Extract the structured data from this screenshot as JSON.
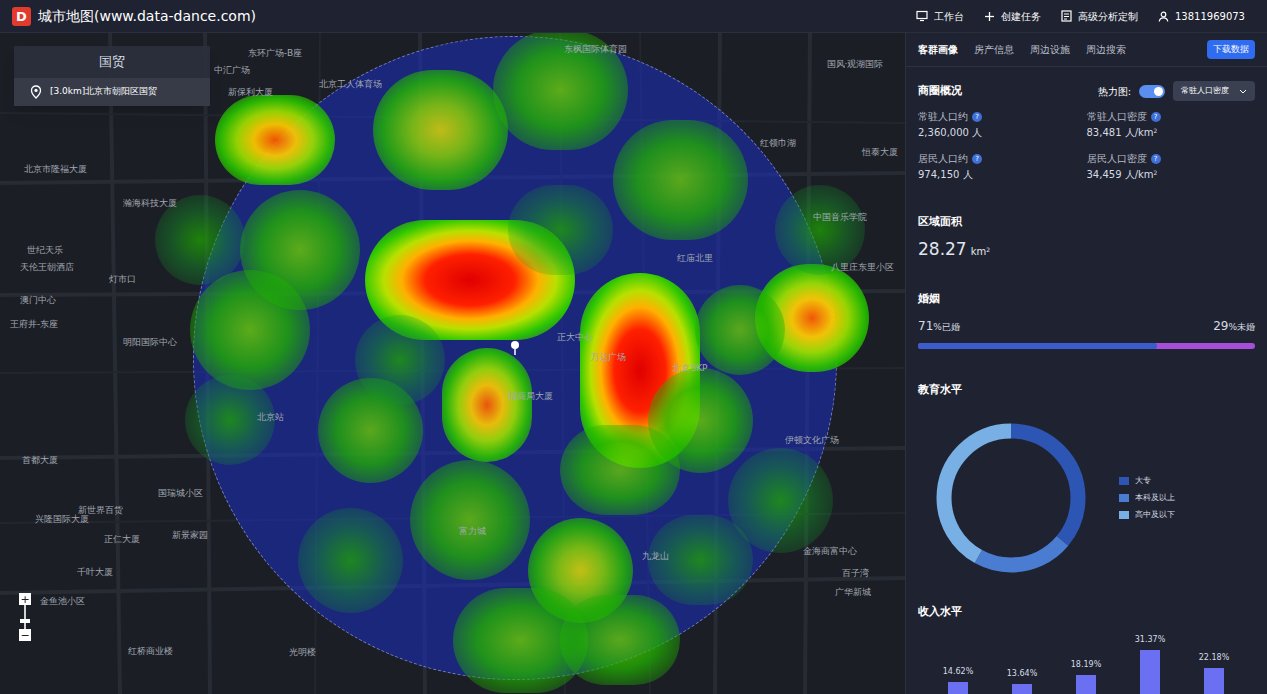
{
  "app": {
    "logo": "D",
    "title": "城市地图(www.data-dance.com)"
  },
  "toolbar": [
    {
      "label": "工作台",
      "kind": "monitor"
    },
    {
      "label": "创建任务",
      "kind": "plus"
    },
    {
      "label": "高级分析定制",
      "kind": "doc"
    },
    {
      "label": "13811969073",
      "kind": "user"
    }
  ],
  "search_card": {
    "title": "国贸",
    "results": [
      {
        "label": "[3.0km]北京市朝阳区国贸"
      }
    ]
  },
  "map": {
    "labels": [
      "中汇广场",
      "东环广场-B座",
      "新保利大厦",
      "北京市隆福大厦",
      "瀚海科技大厦",
      "北京工人体育场",
      "东枫国际体育园",
      "国风·观湖国际",
      "红领巾湖",
      "恒泰大厦",
      "中国音乐学院",
      "八里庄东里小区",
      "红庙北里",
      "正大中心",
      "万达广场",
      "北京SKP",
      "北京站",
      "富力城",
      "新世界百货",
      "新景家园",
      "世纪天乐",
      "天伦王朝酒店",
      "灯市口",
      "澳门中心",
      "王府井-东座",
      "明阳国际中心",
      "兴隆国际大厦",
      "正仁大厦",
      "千叶大厦",
      "金鱼池小区",
      "红桥商业楼",
      "光明楼",
      "伊顿文化广场",
      "金海商富中心",
      "百子湾",
      "广华新城",
      "首都大厦",
      "国瑞城小区",
      "招商局大厦",
      "九龙山"
    ],
    "heat": [
      {
        "level": 1.0
      },
      {
        "level": 1.0
      },
      {
        "level": 0.8
      },
      {
        "level": 0.85
      },
      {
        "level": 0.75
      },
      {
        "level": 0.55
      },
      {
        "level": 0.5
      },
      {
        "level": 0.45
      },
      {
        "level": 0.45
      },
      {
        "level": 0.45
      },
      {
        "level": 0.45
      },
      {
        "level": 0.4
      },
      {
        "level": 0.4
      },
      {
        "level": 0.4
      },
      {
        "level": 0.4
      },
      {
        "level": 0.35
      },
      {
        "level": 0.35
      },
      {
        "level": 0.4
      },
      {
        "level": 0.45
      },
      {
        "level": 0.35
      },
      {
        "level": 0.3
      },
      {
        "level": 0.3
      },
      {
        "level": 0.4
      },
      {
        "level": 0.35
      },
      {
        "level": 0.35
      },
      {
        "level": 0.35
      }
    ],
    "zoom": {
      "in": "+",
      "out": "−"
    }
  },
  "panel": {
    "tabs": [
      {
        "label": "客群画像",
        "selected": true
      },
      {
        "label": "房产信息",
        "selected": false
      },
      {
        "label": "周边设施",
        "selected": false
      },
      {
        "label": "周边搜索",
        "selected": false
      }
    ],
    "download": "下载数据",
    "overview": {
      "title": "商圈概况",
      "heatmap_label": "热力图:",
      "heatmap_on": true,
      "heatmap_layer": "常驻人口密度",
      "stats": [
        {
          "label": "常驻人口约",
          "help": "?",
          "value": "2,360,000 人"
        },
        {
          "label": "常驻人口密度",
          "help": "?",
          "value": "83,481 人/km",
          "sup": "2"
        },
        {
          "label": "居民人口约",
          "help": "?",
          "value": "974,150 人"
        },
        {
          "label": "居民人口密度",
          "help": "?",
          "value": "34,459 人/km",
          "sup": "2"
        }
      ]
    },
    "area": {
      "title": "区域面积",
      "value": "28.27",
      "unit": "km",
      "sup": "2"
    },
    "marriage": {
      "title": "婚姻",
      "married": {
        "value": "71",
        "unit": "%已婚"
      },
      "unmarried": {
        "value": "29",
        "unit": "%未婚"
      },
      "level": 0.71
    },
    "education": {
      "title": "教育水平",
      "segments": [
        {
          "label": "大专",
          "value": 0.36,
          "color": "#2d56b4"
        },
        {
          "label": "本科及以上",
          "value": 0.22,
          "color": "#4a7cd2"
        },
        {
          "label": "高中及以下",
          "value": 0.42,
          "color": "#78b0e6"
        }
      ]
    },
    "income": {
      "title": "收入水平",
      "values": [
        14.62,
        13.64,
        18.19,
        31.37,
        22.18
      ],
      "labels": [
        "14.62%",
        "13.64%",
        "18.19%",
        "31.37%",
        "22.18%"
      ]
    }
  }
}
